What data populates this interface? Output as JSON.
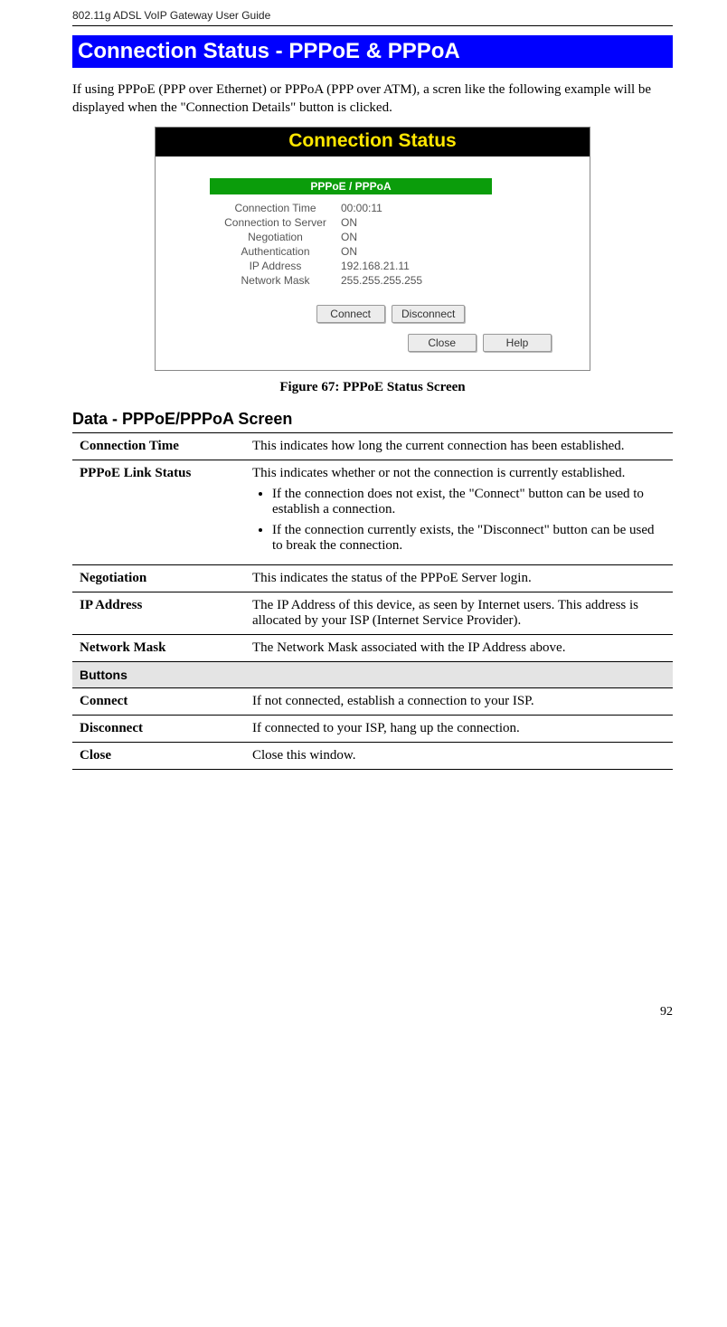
{
  "header": {
    "doc_title": "802.11g ADSL VoIP Gateway User Guide"
  },
  "banner": "Connection Status - PPPoE & PPPoA",
  "intro": "If using PPPoE (PPP over Ethernet) or PPPoA (PPP over ATM), a scren like the following example will be displayed when the \"Connection Details\" button is clicked.",
  "status_window": {
    "title": "Connection Status",
    "badge": "PPPoE / PPPoA",
    "rows": [
      {
        "k": "Connection Time",
        "v": "00:00:11"
      },
      {
        "k": "Connection to Server",
        "v": "ON"
      },
      {
        "k": "Negotiation",
        "v": "ON"
      },
      {
        "k": "Authentication",
        "v": "ON"
      },
      {
        "k": "IP Address",
        "v": "192.168.21.11"
      },
      {
        "k": "Network Mask",
        "v": "255.255.255.255"
      }
    ],
    "buttons_primary": [
      "Connect",
      "Disconnect"
    ],
    "buttons_secondary": [
      "Close",
      "Help"
    ]
  },
  "figure_caption": "Figure 67: PPPoE Status Screen",
  "subheading": "Data - PPPoE/PPPoA Screen",
  "table": {
    "rows": [
      {
        "label": "Connection Time",
        "desc": "This indicates how long the current connection has been established."
      },
      {
        "label": "PPPoE Link Status",
        "desc": "This indicates whether or not the connection is currently established.",
        "bullets": [
          "If the connection does not exist, the \"Connect\" button can be used to establish a connection.",
          "If the connection currently exists, the \"Disconnect\" button can be used to break the connection."
        ]
      },
      {
        "label": "Negotiation",
        "desc": "This indicates the status of the PPPoE Server login."
      },
      {
        "label": "IP Address",
        "desc": "The IP Address of this device, as seen by Internet users. This address is allocated by your ISP (Internet Service Provider)."
      },
      {
        "label": "Network Mask",
        "desc": "The Network Mask associated with the IP Address above."
      }
    ],
    "section_label": "Buttons",
    "button_rows": [
      {
        "label": "Connect",
        "desc": "If not connected, establish a connection to your ISP."
      },
      {
        "label": "Disconnect",
        "desc": "If connected to your ISP, hang up the connection."
      },
      {
        "label": "Close",
        "desc": "Close this window."
      }
    ]
  },
  "page_number": "92"
}
